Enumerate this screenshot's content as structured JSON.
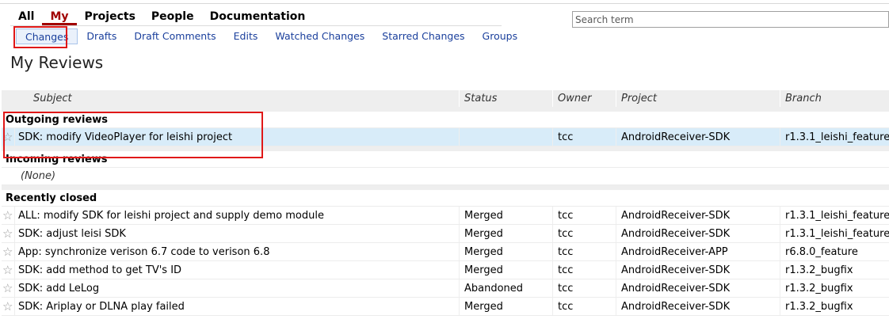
{
  "main_menu": [
    "All",
    "My",
    "Projects",
    "People",
    "Documentation"
  ],
  "main_menu_active": "My",
  "sub_menu": [
    "Changes",
    "Drafts",
    "Draft Comments",
    "Edits",
    "Watched Changes",
    "Starred Changes",
    "Groups"
  ],
  "sub_menu_active": "Changes",
  "search": {
    "placeholder": "Search term"
  },
  "page_title": "My Reviews",
  "columns": {
    "subject": "Subject",
    "status": "Status",
    "owner": "Owner",
    "project": "Project",
    "branch": "Branch"
  },
  "sections": {
    "outgoing": {
      "title": "Outgoing reviews",
      "rows": [
        {
          "subject": "SDK: modify VideoPlayer for leishi project",
          "status": "",
          "owner": "tcc",
          "project": "AndroidReceiver-SDK",
          "branch": "r1.3.1_leishi_feature"
        }
      ]
    },
    "incoming": {
      "title": "Incoming reviews",
      "empty": "(None)"
    },
    "closed": {
      "title": "Recently closed",
      "rows": [
        {
          "subject": "ALL: modify SDK for leishi project and supply demo module",
          "status": "Merged",
          "owner": "tcc",
          "project": "AndroidReceiver-SDK",
          "branch": "r1.3.1_leishi_feature"
        },
        {
          "subject": "SDK: adjust leisi SDK",
          "status": "Merged",
          "owner": "tcc",
          "project": "AndroidReceiver-SDK",
          "branch": "r1.3.1_leishi_feature"
        },
        {
          "subject": "App: synchronize verison 6.7 code to verison 6.8",
          "status": "Merged",
          "owner": "tcc",
          "project": "AndroidReceiver-APP",
          "branch": "r6.8.0_feature"
        },
        {
          "subject": "SDK: add method to get TV's ID",
          "status": "Merged",
          "owner": "tcc",
          "project": "AndroidReceiver-SDK",
          "branch": "r1.3.2_bugfix"
        },
        {
          "subject": "SDK: add LeLog",
          "status": "Abandoned",
          "owner": "tcc",
          "project": "AndroidReceiver-SDK",
          "branch": "r1.3.2_bugfix"
        },
        {
          "subject": "SDK: Ariplay or DLNA play failed",
          "status": "Merged",
          "owner": "tcc",
          "project": "AndroidReceiver-SDK",
          "branch": "r1.3.2_bugfix"
        }
      ]
    }
  },
  "colors": {
    "active_menu": "#a00000",
    "link": "#1a3f9c",
    "highlight_box": "#e01818",
    "selected_row": "#d8ecf9"
  },
  "icons": {
    "star": "star-icon"
  }
}
